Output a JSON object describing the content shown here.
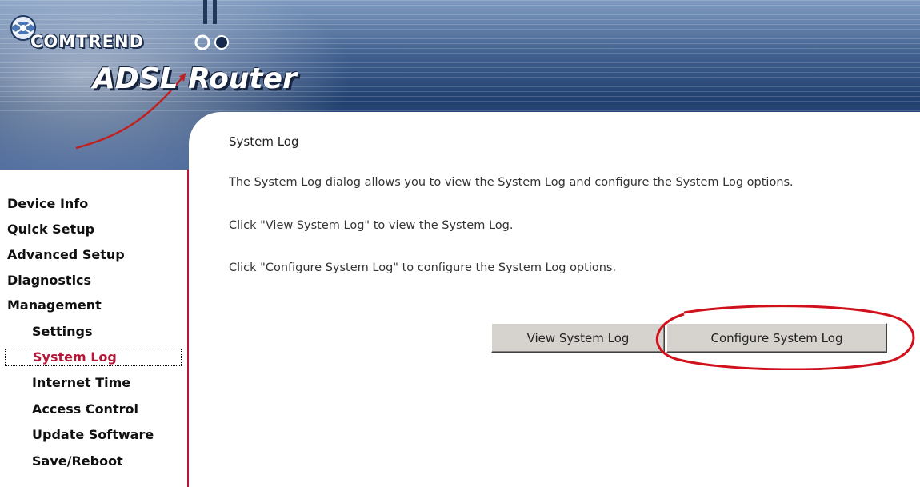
{
  "header": {
    "brand": "COMTREND",
    "product": "ADSL Router"
  },
  "sidebar": {
    "items": [
      {
        "label": "Device Info"
      },
      {
        "label": "Quick Setup"
      },
      {
        "label": "Advanced Setup"
      },
      {
        "label": "Diagnostics"
      },
      {
        "label": "Management"
      }
    ],
    "management_items": [
      {
        "label": "Settings"
      },
      {
        "label": "System Log"
      },
      {
        "label": "Internet Time"
      },
      {
        "label": "Access Control"
      },
      {
        "label": "Update Software"
      },
      {
        "label": "Save/Reboot"
      }
    ],
    "active": "System Log"
  },
  "main": {
    "title": "System Log",
    "paragraphs": [
      "The System Log dialog allows you to view the System Log and configure the System Log options.",
      "Click \"View System Log\" to view the System Log.",
      "Click \"Configure System Log\" to configure the System Log options."
    ],
    "buttons": {
      "view": "View System Log",
      "configure": "Configure System Log"
    }
  },
  "colors": {
    "accent": "#b7183a",
    "highlight_oval": "#d0101a",
    "button_face": "#d6d3ce"
  }
}
